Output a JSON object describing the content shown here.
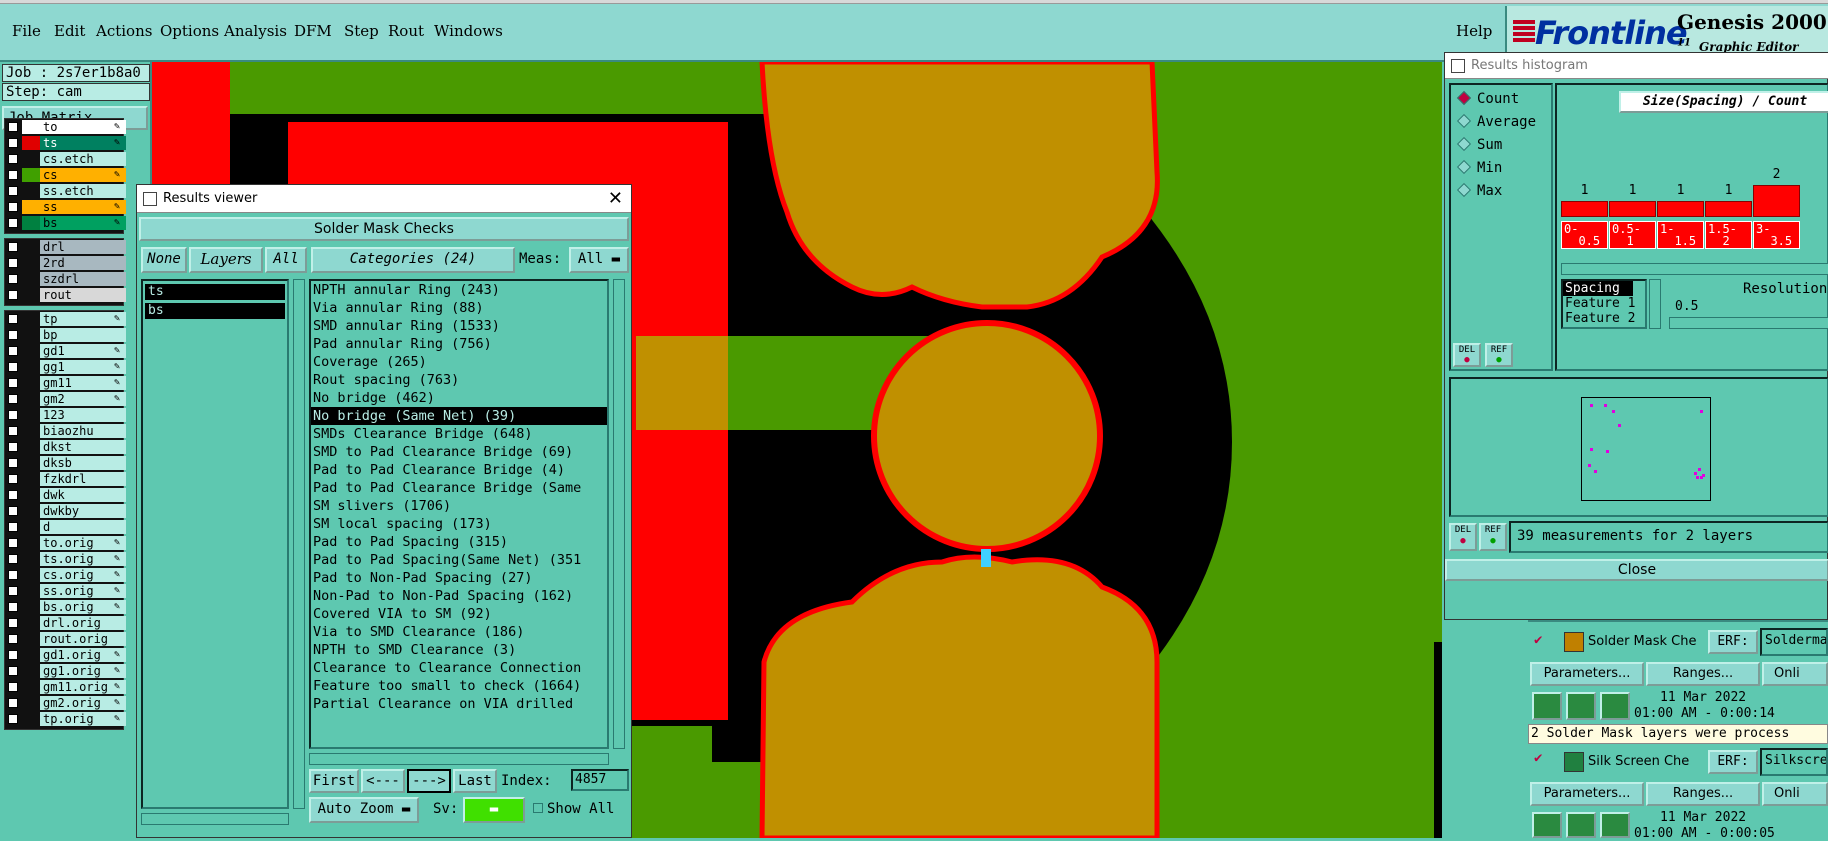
{
  "menubar": {
    "items": [
      "File",
      "Edit",
      "Actions",
      "Options",
      "Analysis",
      "DFM",
      "Step",
      "Rout",
      "Windows"
    ],
    "help": "Help"
  },
  "logo": {
    "brand": "Frontline",
    "product": "Genesis 2000",
    "version_fragment": "11",
    "subtitle": "Graphic Editor"
  },
  "job": {
    "job_label": "Job : 2s7er1b8a0",
    "step_label": "Step: cam",
    "matrix_button": "Job Matrix ..."
  },
  "layers": {
    "group1": [
      {
        "name": "to",
        "color": "#ffffff",
        "editable": true
      },
      {
        "name": "ts",
        "color": "#e00000",
        "editable": true
      },
      {
        "name": "cs.etch",
        "color": "",
        "editable": false
      },
      {
        "name": "cs",
        "color": "#40a000",
        "editable": true
      },
      {
        "name": "ss.etch",
        "color": "",
        "editable": false
      },
      {
        "name": "ss",
        "color": "#ffb000",
        "editable": true
      },
      {
        "name": "bs",
        "color": "#008040",
        "editable": true
      }
    ],
    "group2": [
      {
        "name": "drl"
      },
      {
        "name": "2rd"
      },
      {
        "name": "szdrl"
      },
      {
        "name": "rout"
      }
    ],
    "group3": [
      {
        "name": "tp"
      },
      {
        "name": "bp"
      },
      {
        "name": "gd1"
      },
      {
        "name": "gg1"
      },
      {
        "name": "gm11"
      },
      {
        "name": "gm2"
      },
      {
        "name": "123"
      },
      {
        "name": "biaozhu"
      },
      {
        "name": "dkst"
      },
      {
        "name": "dksb"
      },
      {
        "name": "fzkdrl"
      },
      {
        "name": "dwk"
      },
      {
        "name": "dwkby"
      },
      {
        "name": "d"
      },
      {
        "name": "to.orig"
      },
      {
        "name": "ts.orig"
      },
      {
        "name": "cs.orig"
      },
      {
        "name": "ss.orig"
      },
      {
        "name": "bs.orig"
      },
      {
        "name": "drl.orig"
      },
      {
        "name": "rout.orig"
      },
      {
        "name": "gd1.orig"
      },
      {
        "name": "gg1.orig"
      },
      {
        "name": "gm11.orig"
      },
      {
        "name": "gm2.orig"
      },
      {
        "name": "tp.orig"
      }
    ]
  },
  "results_viewer": {
    "title": "Results viewer",
    "header": "Solder Mask Checks",
    "none_btn": "None",
    "layers_btn": "Layers",
    "all_btn": "All",
    "categories_btn": "Categories (24)",
    "meas_label": "Meas:",
    "meas_value": "All",
    "layers": [
      "ts",
      "bs"
    ],
    "categories": [
      "NPTH annular Ring (243)",
      "Via annular Ring (88)",
      "SMD annular Ring (1533)",
      "Pad annular Ring (756)",
      "Coverage (265)",
      "Rout spacing (763)",
      "No bridge (462)",
      "No bridge (Same Net) (39)",
      "SMDs Clearance Bridge (648)",
      "SMD to Pad Clearance Bridge (69)",
      "Pad to Pad Clearance Bridge (4)",
      "Pad to Pad Clearance Bridge (Same",
      "SM slivers (1706)",
      "SM local spacing (173)",
      "Pad to Pad Spacing (315)",
      "Pad to Pad Spacing(Same Net) (351",
      "Pad to Non-Pad Spacing (27)",
      "Non-Pad to Non-Pad Spacing (162)",
      "Covered VIA to SM (92)",
      "Via to SMD Clearance (186)",
      "NPTH to SMD Clearance (3)",
      "Clearance to Clearance Connection",
      "Feature too small to check (1664)",
      "Partial Clearance on VIA drilled"
    ],
    "selected_index": 7,
    "first_btn": "First",
    "prev_btn": "<---",
    "next_btn": "--->",
    "last_btn": "Last",
    "index_label": "Index:",
    "index_value": "4857",
    "autozoom_btn": "Auto Zoom",
    "sv_label": "Sv:",
    "show_all_label": "Show All"
  },
  "histogram": {
    "title": "Results histogram",
    "modes": [
      "Count",
      "Average",
      "Sum",
      "Min",
      "Max"
    ],
    "selected_mode": "Count",
    "chart_title": "Size(Spacing) / Count",
    "bins": [
      {
        "count": "1",
        "range": "0-\n0.5"
      },
      {
        "count": "1",
        "range": "0.5-\n1"
      },
      {
        "count": "1",
        "range": "1-\n1.5"
      },
      {
        "count": "1",
        "range": "1.5-\n2"
      },
      {
        "count": "2",
        "range": "3-\n3.5"
      }
    ],
    "measure_list": [
      "Spacing",
      "Feature 1",
      "Feature 2"
    ],
    "resolution_label": "Resolution",
    "resolution_value": "0.5",
    "del_label": "DEL",
    "ref_label": "REF",
    "status": "39 measurements for 2 layers",
    "close_btn": "Close"
  },
  "checks": {
    "solder": {
      "name": "Solder Mask Che",
      "erf_label": "ERF:",
      "erf_value": "Soldermas",
      "params": "Parameters...",
      "ranges": "Ranges...",
      "online": "Onli",
      "date": "11 Mar 2022",
      "time": "01:00 AM - 0:00:14",
      "message": "2 Solder Mask layers were process"
    },
    "silk": {
      "name": "Silk Screen Che",
      "erf_label": "ERF:",
      "erf_value": "Silkscree",
      "params": "Parameters...",
      "ranges": "Ranges...",
      "online": "Onli",
      "date": "11 Mar 2022",
      "time": "01:00 AM - 0:00:05"
    }
  }
}
